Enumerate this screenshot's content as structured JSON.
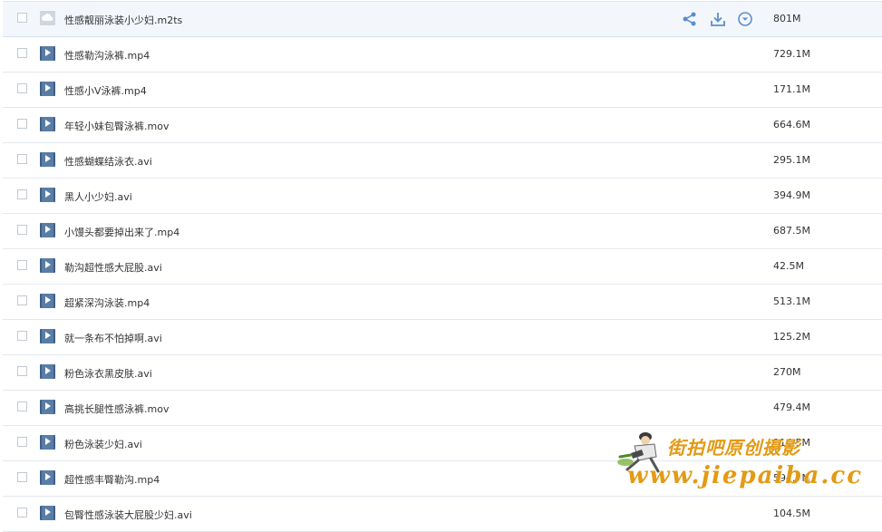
{
  "files": [
    {
      "name": "性感靓丽泳装小少妇.m2ts",
      "size": "801M",
      "icon": "cloud-file-icon",
      "hover": true
    },
    {
      "name": "性感勒沟泳裤.mp4",
      "size": "729.1M",
      "icon": "video-file-icon"
    },
    {
      "name": "性感小V泳裤.mp4",
      "size": "171.1M",
      "icon": "video-file-icon"
    },
    {
      "name": "年轻小妹包臀泳裤.mov",
      "size": "664.6M",
      "icon": "video-file-icon"
    },
    {
      "name": "性感蝴蝶结泳衣.avi",
      "size": "295.1M",
      "icon": "video-file-icon"
    },
    {
      "name": "黑人小少妇.avi",
      "size": "394.9M",
      "icon": "video-file-icon"
    },
    {
      "name": "小馒头都要掉出来了.mp4",
      "size": "687.5M",
      "icon": "video-file-icon"
    },
    {
      "name": "勒沟超性感大屁股.avi",
      "size": "42.5M",
      "icon": "video-file-icon"
    },
    {
      "name": "超紧深沟泳装.mp4",
      "size": "513.1M",
      "icon": "video-file-icon"
    },
    {
      "name": "就一条布不怕掉啊.avi",
      "size": "125.2M",
      "icon": "video-file-icon"
    },
    {
      "name": "粉色泳衣黑皮肤.avi",
      "size": "270M",
      "icon": "video-file-icon"
    },
    {
      "name": "高挑长腿性感泳裤.mov",
      "size": "479.4M",
      "icon": "video-file-icon"
    },
    {
      "name": "粉色泳装少妇.avi",
      "size": "114.5M",
      "icon": "video-file-icon"
    },
    {
      "name": "超性感丰臀勒沟.mp4",
      "size": "594.4M",
      "icon": "video-file-icon"
    },
    {
      "name": "包臀性感泳装大屁股少妇.avi",
      "size": "104.5M",
      "icon": "video-file-icon"
    }
  ],
  "row_actions": [
    "share-icon",
    "download-icon",
    "more-dropdown-icon"
  ],
  "watermark": {
    "cn": "街拍吧原创摄影",
    "url": "www.jiepaiba.cc"
  },
  "colors": {
    "accent": "#5b8fc9",
    "watermark": "#e39a14",
    "hover_row": "#f3f7fc"
  }
}
